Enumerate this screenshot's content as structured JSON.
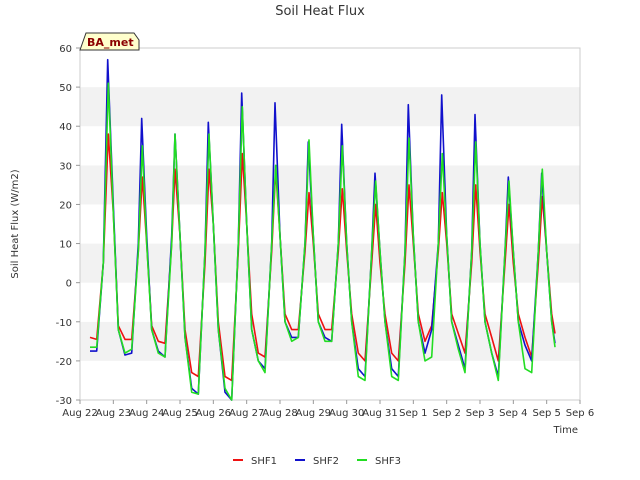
{
  "chart_data": {
    "type": "line",
    "title": "Soil Heat Flux",
    "xlabel": "Time",
    "ylabel": "Soil Heat Flux (W/m2)",
    "badge": "BA_met",
    "ylim": [
      -30,
      60
    ],
    "yticks": [
      -30,
      -20,
      -10,
      0,
      10,
      20,
      30,
      40,
      50,
      60
    ],
    "xlim": [
      0,
      15
    ],
    "xticks": [
      {
        "value": 0,
        "label": "Aug 22"
      },
      {
        "value": 1,
        "label": "Aug 23"
      },
      {
        "value": 2,
        "label": "Aug 24"
      },
      {
        "value": 3,
        "label": "Aug 25"
      },
      {
        "value": 4,
        "label": "Aug 26"
      },
      {
        "value": 5,
        "label": "Aug 27"
      },
      {
        "value": 6,
        "label": "Aug 28"
      },
      {
        "value": 7,
        "label": "Aug 29"
      },
      {
        "value": 8,
        "label": "Aug 30"
      },
      {
        "value": 9,
        "label": "Aug 31"
      },
      {
        "value": 10,
        "label": "Sep 1"
      },
      {
        "value": 11,
        "label": "Sep 2"
      },
      {
        "value": 12,
        "label": "Sep 3"
      },
      {
        "value": 13,
        "label": "Sep 4"
      },
      {
        "value": 14,
        "label": "Sep 5"
      },
      {
        "value": 15,
        "label": "Sep 6"
      }
    ],
    "grid": "horizontal bands",
    "legend_position": "bottom-center",
    "series": [
      {
        "name": "SHF1",
        "color": "#ee1111",
        "points": [
          [
            0.3,
            -14
          ],
          [
            0.5,
            -14.5
          ],
          [
            0.7,
            5
          ],
          [
            0.85,
            38
          ],
          [
            1.0,
            18
          ],
          [
            1.15,
            -11
          ],
          [
            1.35,
            -14.5
          ],
          [
            1.55,
            -14.5
          ],
          [
            1.75,
            8
          ],
          [
            1.87,
            27
          ],
          [
            2.0,
            10
          ],
          [
            2.15,
            -11
          ],
          [
            2.35,
            -15
          ],
          [
            2.55,
            -15.5
          ],
          [
            2.75,
            10
          ],
          [
            2.85,
            29
          ],
          [
            3.0,
            12
          ],
          [
            3.15,
            -12
          ],
          [
            3.35,
            -23
          ],
          [
            3.55,
            -24
          ],
          [
            3.75,
            5
          ],
          [
            3.87,
            29
          ],
          [
            4.0,
            15
          ],
          [
            4.15,
            -10
          ],
          [
            4.35,
            -24
          ],
          [
            4.55,
            -25
          ],
          [
            4.75,
            8
          ],
          [
            4.87,
            33
          ],
          [
            5.0,
            15
          ],
          [
            5.15,
            -8
          ],
          [
            5.35,
            -18
          ],
          [
            5.55,
            -19
          ],
          [
            5.75,
            8
          ],
          [
            5.87,
            29
          ],
          [
            6.0,
            12
          ],
          [
            6.15,
            -8
          ],
          [
            6.35,
            -12
          ],
          [
            6.55,
            -12
          ],
          [
            6.75,
            8
          ],
          [
            6.87,
            23
          ],
          [
            7.0,
            10
          ],
          [
            7.15,
            -8
          ],
          [
            7.35,
            -12
          ],
          [
            7.55,
            -12
          ],
          [
            7.75,
            8
          ],
          [
            7.87,
            24
          ],
          [
            8.0,
            8
          ],
          [
            8.15,
            -8
          ],
          [
            8.35,
            -18
          ],
          [
            8.55,
            -20
          ],
          [
            8.75,
            5
          ],
          [
            8.87,
            20
          ],
          [
            9.0,
            5
          ],
          [
            9.15,
            -8
          ],
          [
            9.35,
            -18
          ],
          [
            9.55,
            -20
          ],
          [
            9.75,
            5
          ],
          [
            9.87,
            25
          ],
          [
            10.0,
            10
          ],
          [
            10.15,
            -8
          ],
          [
            10.35,
            -15
          ],
          [
            10.55,
            -11
          ],
          [
            10.75,
            8
          ],
          [
            10.87,
            23
          ],
          [
            11.0,
            10
          ],
          [
            11.15,
            -8
          ],
          [
            11.35,
            -13
          ],
          [
            11.55,
            -18
          ],
          [
            11.75,
            5
          ],
          [
            11.87,
            25
          ],
          [
            12.0,
            8
          ],
          [
            12.15,
            -8
          ],
          [
            12.35,
            -14
          ],
          [
            12.55,
            -20
          ],
          [
            12.75,
            5
          ],
          [
            12.87,
            20
          ],
          [
            13.0,
            5
          ],
          [
            13.15,
            -8
          ],
          [
            13.35,
            -14
          ],
          [
            13.55,
            -19
          ],
          [
            13.75,
            5
          ],
          [
            13.87,
            22
          ],
          [
            14.0,
            8
          ],
          [
            14.15,
            -8
          ],
          [
            14.25,
            -13
          ]
        ]
      },
      {
        "name": "SHF2",
        "color": "#1111cc",
        "points": [
          [
            0.3,
            -17.5
          ],
          [
            0.5,
            -17.5
          ],
          [
            0.7,
            5
          ],
          [
            0.83,
            57
          ],
          [
            1.0,
            20
          ],
          [
            1.15,
            -12
          ],
          [
            1.35,
            -18.5
          ],
          [
            1.55,
            -18
          ],
          [
            1.75,
            10
          ],
          [
            1.85,
            42
          ],
          [
            2.0,
            12
          ],
          [
            2.15,
            -12
          ],
          [
            2.35,
            -17.5
          ],
          [
            2.55,
            -19
          ],
          [
            2.75,
            12
          ],
          [
            2.85,
            38
          ],
          [
            3.0,
            12
          ],
          [
            3.15,
            -14
          ],
          [
            3.35,
            -27
          ],
          [
            3.55,
            -28.5
          ],
          [
            3.75,
            8
          ],
          [
            3.85,
            41
          ],
          [
            4.0,
            15
          ],
          [
            4.15,
            -12
          ],
          [
            4.35,
            -28
          ],
          [
            4.55,
            -30
          ],
          [
            4.75,
            10
          ],
          [
            4.85,
            48.5
          ],
          [
            5.0,
            15
          ],
          [
            5.15,
            -12
          ],
          [
            5.35,
            -20
          ],
          [
            5.55,
            -22
          ],
          [
            5.75,
            10
          ],
          [
            5.85,
            46
          ],
          [
            6.0,
            12
          ],
          [
            6.15,
            -10
          ],
          [
            6.35,
            -14
          ],
          [
            6.55,
            -14
          ],
          [
            6.75,
            10
          ],
          [
            6.85,
            36
          ],
          [
            7.0,
            12
          ],
          [
            7.15,
            -10
          ],
          [
            7.35,
            -14
          ],
          [
            7.55,
            -15
          ],
          [
            7.75,
            10
          ],
          [
            7.85,
            40.5
          ],
          [
            8.0,
            10
          ],
          [
            8.15,
            -10
          ],
          [
            8.35,
            -22
          ],
          [
            8.55,
            -24
          ],
          [
            8.75,
            8
          ],
          [
            8.85,
            28
          ],
          [
            9.0,
            8
          ],
          [
            9.15,
            -10
          ],
          [
            9.35,
            -22
          ],
          [
            9.55,
            -24
          ],
          [
            9.75,
            8
          ],
          [
            9.85,
            45.5
          ],
          [
            10.0,
            12
          ],
          [
            10.15,
            -10
          ],
          [
            10.35,
            -18
          ],
          [
            10.55,
            -12
          ],
          [
            10.75,
            10
          ],
          [
            10.85,
            48
          ],
          [
            11.0,
            12
          ],
          [
            11.15,
            -10
          ],
          [
            11.35,
            -16
          ],
          [
            11.55,
            -22
          ],
          [
            11.75,
            8
          ],
          [
            11.85,
            43
          ],
          [
            12.0,
            10
          ],
          [
            12.15,
            -10
          ],
          [
            12.35,
            -18
          ],
          [
            12.55,
            -24
          ],
          [
            12.75,
            8
          ],
          [
            12.85,
            27
          ],
          [
            13.0,
            8
          ],
          [
            13.15,
            -10
          ],
          [
            13.35,
            -16
          ],
          [
            13.55,
            -20
          ],
          [
            13.75,
            8
          ],
          [
            13.85,
            28
          ],
          [
            14.0,
            8
          ],
          [
            14.15,
            -10
          ],
          [
            14.25,
            -15.5
          ]
        ]
      },
      {
        "name": "SHF3",
        "color": "#22dd22",
        "points": [
          [
            0.3,
            -16.5
          ],
          [
            0.5,
            -16.5
          ],
          [
            0.7,
            5
          ],
          [
            0.85,
            51
          ],
          [
            1.0,
            18
          ],
          [
            1.15,
            -12
          ],
          [
            1.35,
            -18
          ],
          [
            1.55,
            -17
          ],
          [
            1.75,
            8
          ],
          [
            1.87,
            35
          ],
          [
            2.0,
            10
          ],
          [
            2.15,
            -12
          ],
          [
            2.35,
            -18
          ],
          [
            2.55,
            -19
          ],
          [
            2.75,
            10
          ],
          [
            2.85,
            38
          ],
          [
            3.0,
            12
          ],
          [
            3.15,
            -14
          ],
          [
            3.35,
            -28
          ],
          [
            3.55,
            -28.5
          ],
          [
            3.75,
            8
          ],
          [
            3.87,
            38
          ],
          [
            4.0,
            15
          ],
          [
            4.15,
            -12
          ],
          [
            4.35,
            -27
          ],
          [
            4.55,
            -30
          ],
          [
            4.75,
            10
          ],
          [
            4.87,
            45
          ],
          [
            5.0,
            15
          ],
          [
            5.15,
            -12
          ],
          [
            5.35,
            -20
          ],
          [
            5.55,
            -23
          ],
          [
            5.75,
            10
          ],
          [
            5.87,
            30
          ],
          [
            6.0,
            12
          ],
          [
            6.15,
            -10
          ],
          [
            6.35,
            -15
          ],
          [
            6.55,
            -14
          ],
          [
            6.75,
            10
          ],
          [
            6.87,
            36.5
          ],
          [
            7.0,
            12
          ],
          [
            7.15,
            -10
          ],
          [
            7.35,
            -15
          ],
          [
            7.55,
            -15
          ],
          [
            7.75,
            10
          ],
          [
            7.87,
            35
          ],
          [
            8.0,
            10
          ],
          [
            8.15,
            -10
          ],
          [
            8.35,
            -24
          ],
          [
            8.55,
            -25
          ],
          [
            8.75,
            8
          ],
          [
            8.87,
            26
          ],
          [
            9.0,
            8
          ],
          [
            9.15,
            -10
          ],
          [
            9.35,
            -24
          ],
          [
            9.55,
            -25
          ],
          [
            9.75,
            8
          ],
          [
            9.87,
            37
          ],
          [
            10.0,
            12
          ],
          [
            10.15,
            -10
          ],
          [
            10.35,
            -20
          ],
          [
            10.55,
            -19
          ],
          [
            10.75,
            10
          ],
          [
            10.87,
            33
          ],
          [
            11.0,
            12
          ],
          [
            11.15,
            -10
          ],
          [
            11.35,
            -17
          ],
          [
            11.55,
            -23
          ],
          [
            11.75,
            8
          ],
          [
            11.87,
            36
          ],
          [
            12.0,
            10
          ],
          [
            12.15,
            -10
          ],
          [
            12.35,
            -18
          ],
          [
            12.55,
            -25
          ],
          [
            12.75,
            8
          ],
          [
            12.87,
            26
          ],
          [
            13.0,
            8
          ],
          [
            13.15,
            -10
          ],
          [
            13.35,
            -22
          ],
          [
            13.55,
            -23
          ],
          [
            13.75,
            8
          ],
          [
            13.87,
            29
          ],
          [
            14.0,
            8
          ],
          [
            14.15,
            -10
          ],
          [
            14.25,
            -16.5
          ]
        ]
      }
    ]
  }
}
